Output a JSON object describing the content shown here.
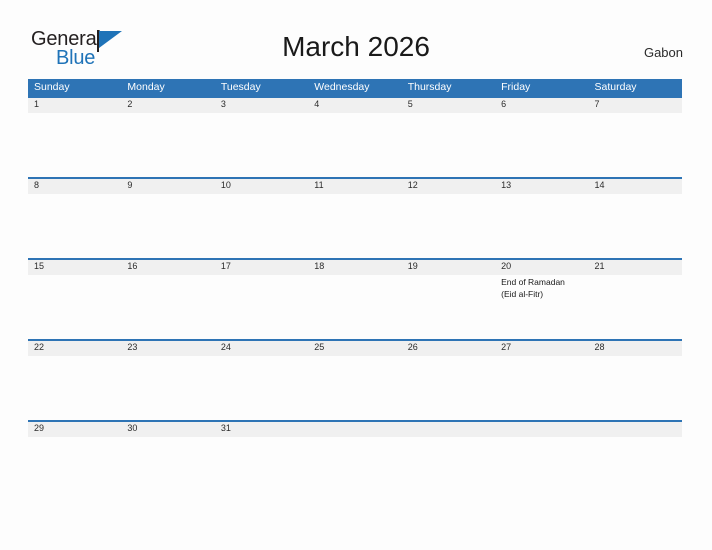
{
  "brand": {
    "name_part1": "General",
    "name_part2": "Blue",
    "flag_icon": "blue-flag-triangle",
    "color_dark": "#231f20",
    "color_blue": "#1f73b8"
  },
  "header": {
    "title": "March 2026",
    "country": "Gabon"
  },
  "calendar": {
    "accent_color": "#2e74b5",
    "band_color": "#f0f0f0",
    "weekdays": [
      "Sunday",
      "Monday",
      "Tuesday",
      "Wednesday",
      "Thursday",
      "Friday",
      "Saturday"
    ],
    "weeks": [
      {
        "days": [
          {
            "num": "1",
            "events": []
          },
          {
            "num": "2",
            "events": []
          },
          {
            "num": "3",
            "events": []
          },
          {
            "num": "4",
            "events": []
          },
          {
            "num": "5",
            "events": []
          },
          {
            "num": "6",
            "events": []
          },
          {
            "num": "7",
            "events": []
          }
        ]
      },
      {
        "days": [
          {
            "num": "8",
            "events": []
          },
          {
            "num": "9",
            "events": []
          },
          {
            "num": "10",
            "events": []
          },
          {
            "num": "11",
            "events": []
          },
          {
            "num": "12",
            "events": []
          },
          {
            "num": "13",
            "events": []
          },
          {
            "num": "14",
            "events": []
          }
        ]
      },
      {
        "days": [
          {
            "num": "15",
            "events": []
          },
          {
            "num": "16",
            "events": []
          },
          {
            "num": "17",
            "events": []
          },
          {
            "num": "18",
            "events": []
          },
          {
            "num": "19",
            "events": []
          },
          {
            "num": "20",
            "events": [
              "End of Ramadan",
              "(Eid al-Fitr)"
            ]
          },
          {
            "num": "21",
            "events": []
          }
        ]
      },
      {
        "days": [
          {
            "num": "22",
            "events": []
          },
          {
            "num": "23",
            "events": []
          },
          {
            "num": "24",
            "events": []
          },
          {
            "num": "25",
            "events": []
          },
          {
            "num": "26",
            "events": []
          },
          {
            "num": "27",
            "events": []
          },
          {
            "num": "28",
            "events": []
          }
        ]
      },
      {
        "days": [
          {
            "num": "29",
            "events": []
          },
          {
            "num": "30",
            "events": []
          },
          {
            "num": "31",
            "events": []
          },
          {
            "num": "",
            "events": []
          },
          {
            "num": "",
            "events": []
          },
          {
            "num": "",
            "events": []
          },
          {
            "num": "",
            "events": []
          }
        ]
      }
    ]
  }
}
